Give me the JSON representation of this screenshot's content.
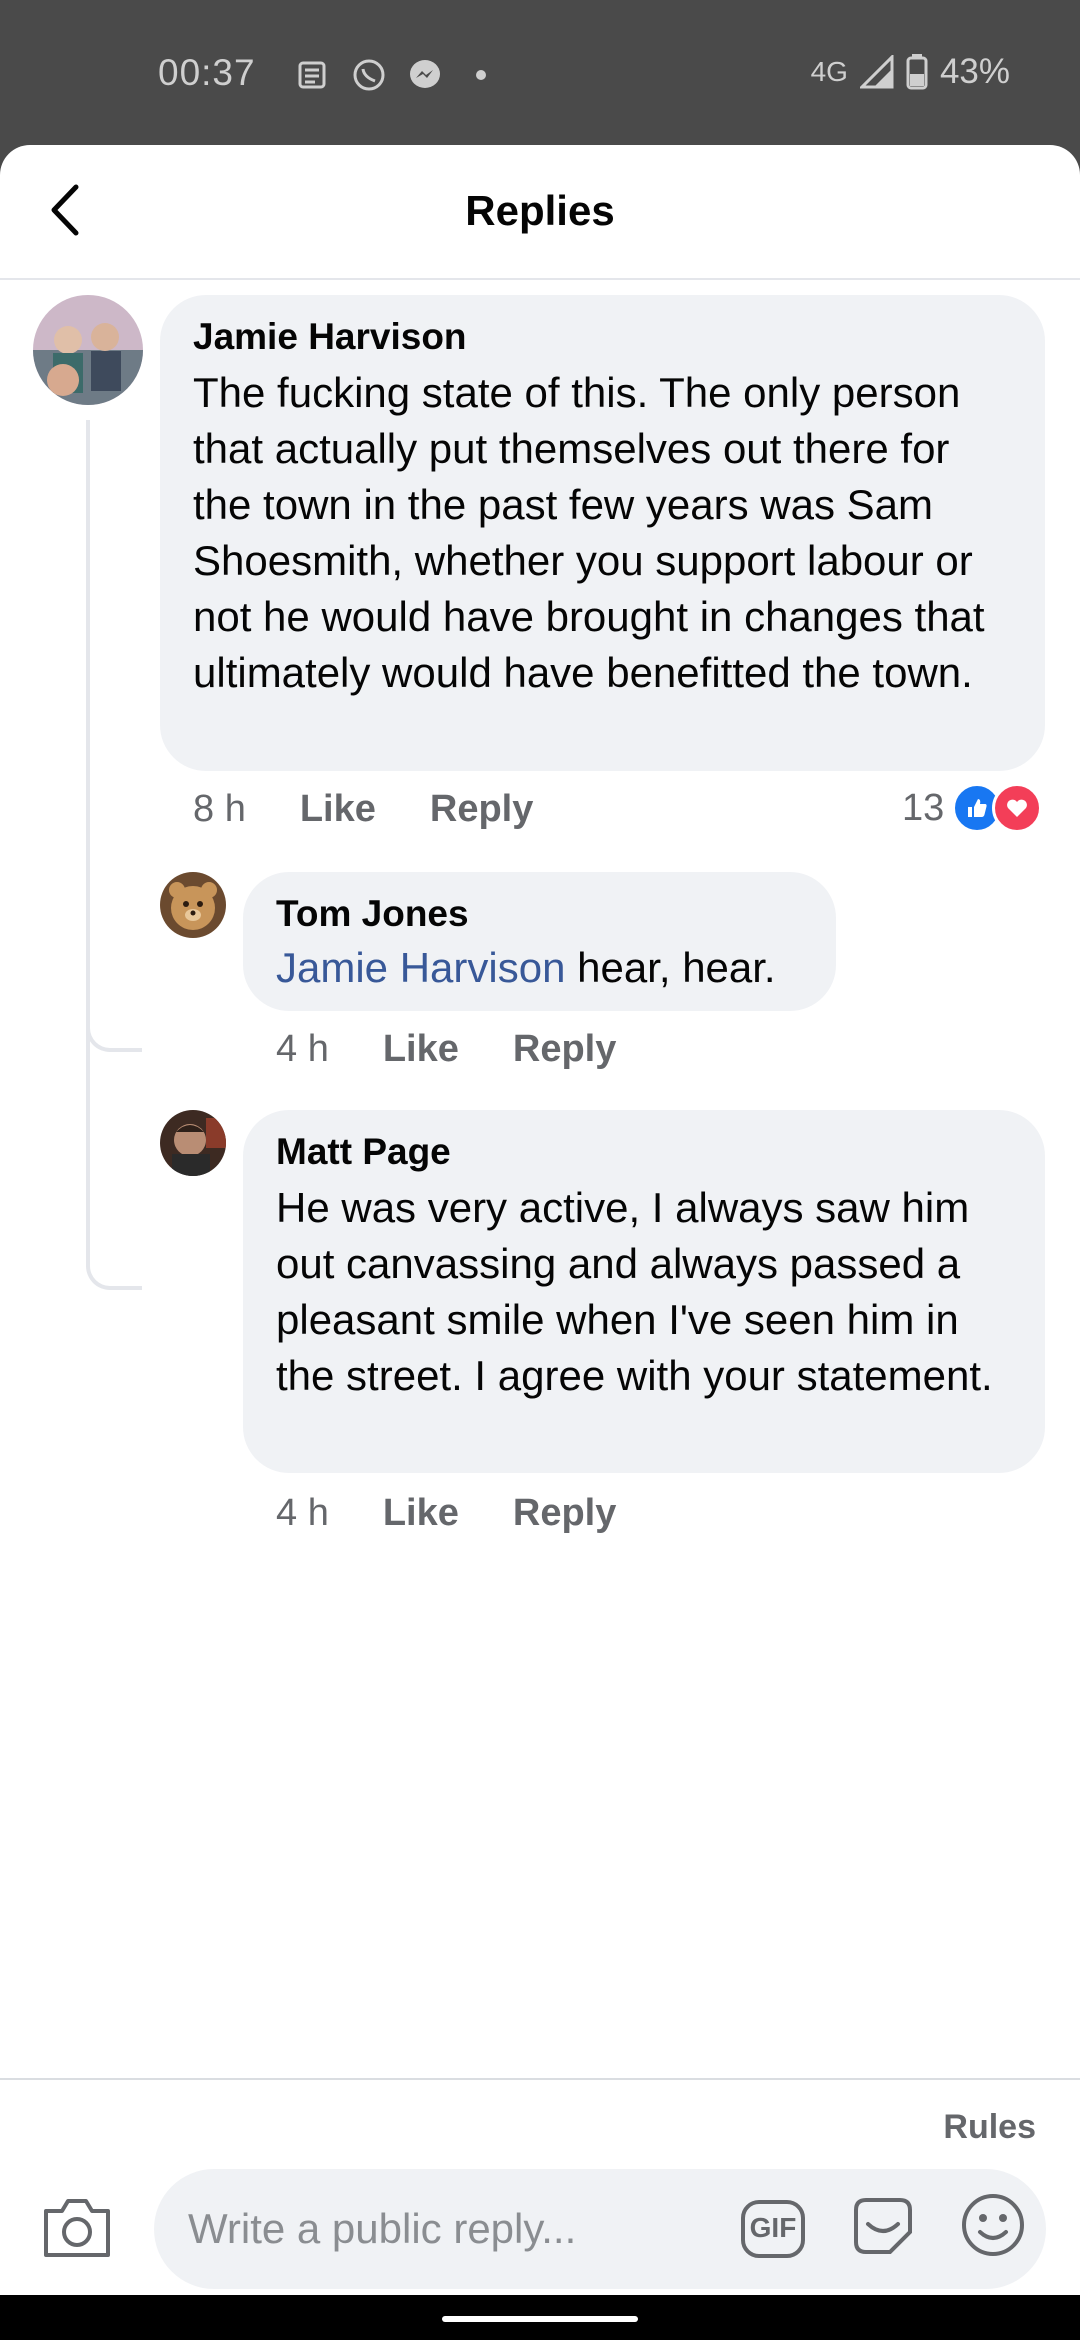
{
  "status_bar": {
    "time": "00:37",
    "network": "4G",
    "battery": "43%",
    "icons": [
      "news-icon",
      "whatsapp-icon",
      "messenger-icon",
      "dot-icon",
      "signal-icon",
      "battery-icon"
    ]
  },
  "header": {
    "title": "Replies",
    "back_icon": "back-arrow-icon"
  },
  "comments": [
    {
      "author": "Jamie Harvison",
      "text": "The fucking state of this. The only person that actually put themselves out there for the town in the past few years was Sam Shoesmith, whether you support labour or not he would have brought in changes that ultimately would have benefitted the town.",
      "time": "8 h",
      "like": "Like",
      "reply": "Reply",
      "reaction_count": "13",
      "reactions": [
        "like-reaction-icon",
        "love-reaction-icon"
      ]
    },
    {
      "author": "Tom Jones",
      "mention": "Jamie Harvison",
      "text": " hear, hear.",
      "time": "4 h",
      "like": "Like",
      "reply": "Reply"
    },
    {
      "author": "Matt Page",
      "text": "He was very active, I always saw him out canvassing and always passed a pleasant smile when I've seen him in the street. I agree with your statement.",
      "time": "4 h",
      "like": "Like",
      "reply": "Reply"
    }
  ],
  "composer": {
    "rules": "Rules",
    "placeholder": "Write a public reply...",
    "gif_label": "GIF"
  },
  "colors": {
    "like_blue": "#1877f2",
    "love_red": "#f33e58",
    "mention": "#385898",
    "bubble": "#f0f2f5"
  }
}
